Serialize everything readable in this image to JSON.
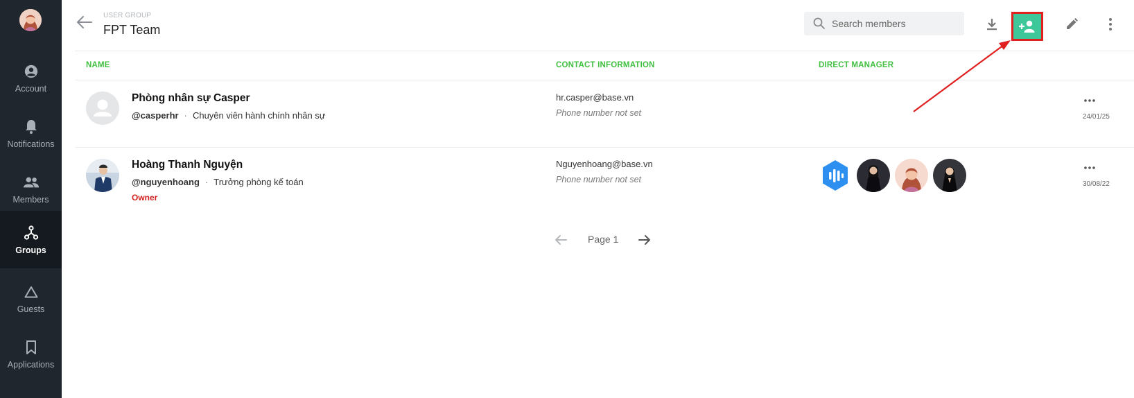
{
  "sidebar": {
    "items": [
      {
        "label": "Account",
        "icon": "account-circle-icon"
      },
      {
        "label": "Notifications",
        "icon": "bell-icon"
      },
      {
        "label": "Members",
        "icon": "members-icon"
      },
      {
        "label": "Groups",
        "icon": "groups-icon",
        "active": true
      },
      {
        "label": "Guests",
        "icon": "triangle-icon"
      },
      {
        "label": "Applications",
        "icon": "bookmark-icon"
      }
    ]
  },
  "header": {
    "breadcrumb": "USER GROUP",
    "title": "FPT Team",
    "search_placeholder": "Search members"
  },
  "table": {
    "columns": [
      "NAME",
      "CONTACT INFORMATION",
      "DIRECT MANAGER"
    ],
    "rows": [
      {
        "name": "Phòng nhân sự Casper",
        "handle": "@casperhr",
        "position": "Chuyên viên hành chính nhân sự",
        "email": "hr.casper@base.vn",
        "phone": "Phone number not set",
        "date": "24/01/25"
      },
      {
        "name": "Hoàng Thanh Nguyện",
        "handle": "@nguyenhoang",
        "position": "Trưởng phòng kế toán",
        "role": "Owner",
        "email": "Nguyenhoang@base.vn",
        "phone": "Phone number not set",
        "date": "30/08/22"
      }
    ]
  },
  "pagination": {
    "label": "Page 1"
  },
  "colors": {
    "accent_green": "#3fbf3f",
    "add_button": "#3ec89a",
    "highlight_red": "#e01f1f",
    "sidebar_bg": "#20262e"
  }
}
